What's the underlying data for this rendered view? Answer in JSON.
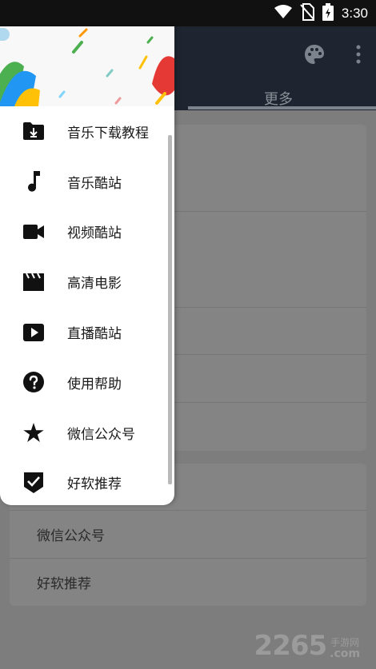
{
  "status_bar": {
    "time": "3:30",
    "icons": [
      "wifi-icon",
      "no-sim-icon",
      "battery-charging-icon"
    ]
  },
  "toolbar": {
    "icons": [
      "palette-icon",
      "more-vert-icon"
    ]
  },
  "tabs": {
    "selected": "更多"
  },
  "drawer": {
    "items": [
      {
        "label": "音乐下载教程",
        "icon": "folder-download-icon"
      },
      {
        "label": "音乐酷站",
        "icon": "music-note-icon"
      },
      {
        "label": "视频酷站",
        "icon": "videocam-icon"
      },
      {
        "label": "高清电影",
        "icon": "movie-clapper-icon"
      },
      {
        "label": "直播酷站",
        "icon": "play-box-icon"
      },
      {
        "label": "使用帮助",
        "icon": "help-icon"
      },
      {
        "label": "微信公众号",
        "icon": "star-icon"
      },
      {
        "label": "好软推荐",
        "icon": "shield-check-icon"
      }
    ]
  },
  "content": {
    "list": [
      {
        "label": "微信公众号"
      },
      {
        "label": "好软推荐"
      }
    ]
  },
  "watermark": {
    "digits": "2265",
    "sub_cn": "手游网",
    "sub_com": ".com"
  },
  "colors": {
    "toolbar": "#1f2530",
    "drawer_bg": "#ffffff",
    "scrim": "#7d7d7d"
  }
}
